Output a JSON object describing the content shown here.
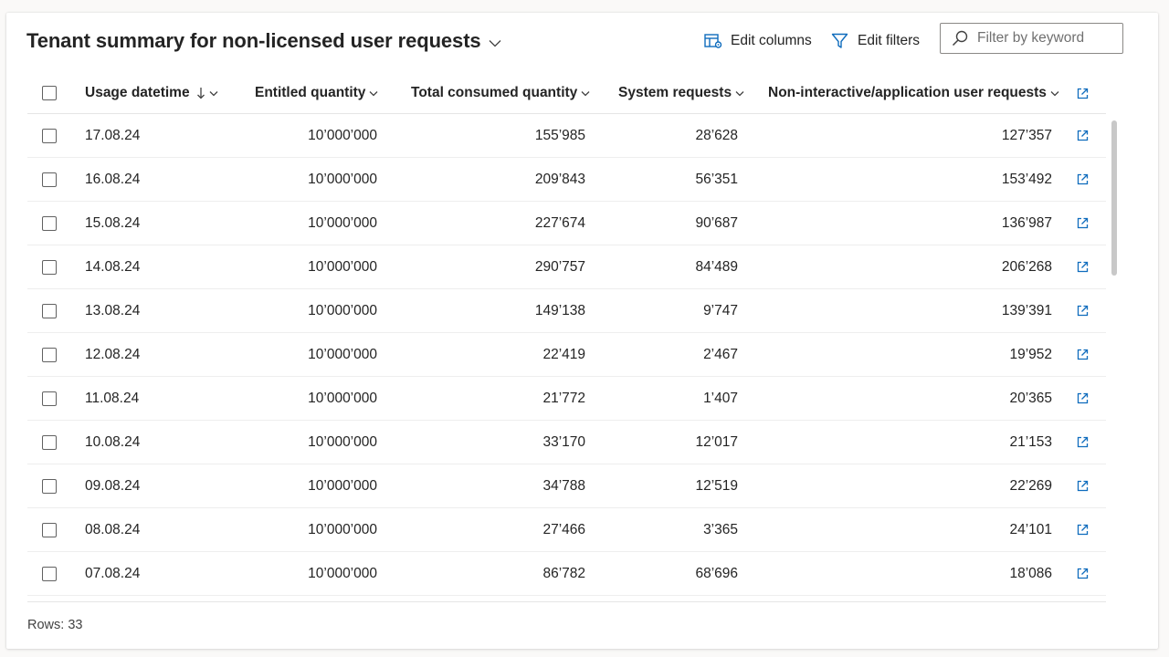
{
  "title": "Tenant summary for non-licensed user requests",
  "toolbar": {
    "edit_columns": "Edit columns",
    "edit_filters": "Edit filters",
    "search_placeholder": "Filter by keyword"
  },
  "columns": {
    "usage_datetime": "Usage datetime",
    "entitled_quantity": "Entitled quantity",
    "total_consumed": "Total consumed quantity",
    "system_requests": "System requests",
    "non_interactive": "Non-interactive/application user requests"
  },
  "rows": [
    {
      "date": "17.08.24",
      "entitled": "10’000’000",
      "total": "155’985",
      "system": "28’628",
      "nonint": "127’357"
    },
    {
      "date": "16.08.24",
      "entitled": "10’000’000",
      "total": "209’843",
      "system": "56’351",
      "nonint": "153’492"
    },
    {
      "date": "15.08.24",
      "entitled": "10’000’000",
      "total": "227’674",
      "system": "90’687",
      "nonint": "136’987"
    },
    {
      "date": "14.08.24",
      "entitled": "10’000’000",
      "total": "290’757",
      "system": "84’489",
      "nonint": "206’268"
    },
    {
      "date": "13.08.24",
      "entitled": "10’000’000",
      "total": "149’138",
      "system": "9’747",
      "nonint": "139’391"
    },
    {
      "date": "12.08.24",
      "entitled": "10’000’000",
      "total": "22’419",
      "system": "2’467",
      "nonint": "19’952"
    },
    {
      "date": "11.08.24",
      "entitled": "10’000’000",
      "total": "21’772",
      "system": "1’407",
      "nonint": "20’365"
    },
    {
      "date": "10.08.24",
      "entitled": "10’000’000",
      "total": "33’170",
      "system": "12’017",
      "nonint": "21’153"
    },
    {
      "date": "09.08.24",
      "entitled": "10’000’000",
      "total": "34’788",
      "system": "12’519",
      "nonint": "22’269"
    },
    {
      "date": "08.08.24",
      "entitled": "10’000’000",
      "total": "27’466",
      "system": "3’365",
      "nonint": "24’101"
    },
    {
      "date": "07.08.24",
      "entitled": "10’000’000",
      "total": "86’782",
      "system": "68’696",
      "nonint": "18’086"
    }
  ],
  "footer": {
    "row_count": "Rows: 33"
  },
  "colors": {
    "accent": "#0f6cbd",
    "border": "#e5e5e5",
    "text": "#242424"
  },
  "icons": {
    "title_dropdown": "chevron-down-icon",
    "edit_columns": "edit-columns-icon",
    "edit_filters": "filter-icon",
    "search": "search-icon",
    "sort": "sort-descending-icon",
    "open": "open-in-new-icon"
  }
}
